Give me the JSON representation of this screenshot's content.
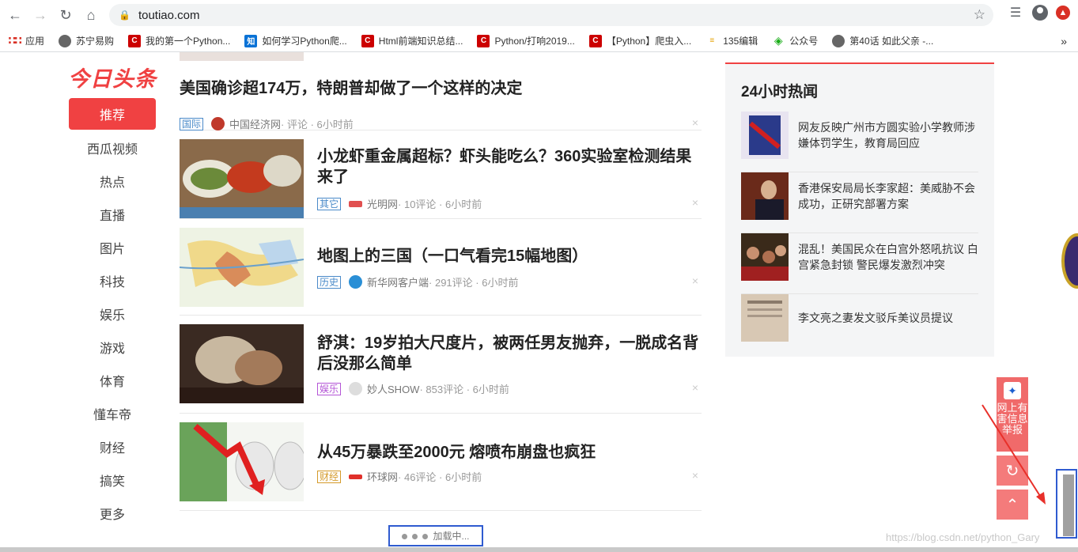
{
  "browser": {
    "url": "toutiao.com",
    "bookmarks": [
      {
        "label": "应用",
        "icon": "apps-icon"
      },
      {
        "label": "苏宁易购",
        "icon": "globe-icon"
      },
      {
        "label": "我的第一个Python...",
        "icon": "csdn-icon"
      },
      {
        "label": "如何学习Python爬...",
        "icon": "zhihu-icon"
      },
      {
        "label": "Html前端知识总结...",
        "icon": "csdn-icon"
      },
      {
        "label": "Python/打响2019...",
        "icon": "csdn-icon"
      },
      {
        "label": "【Python】爬虫入...",
        "icon": "csdn-icon"
      },
      {
        "label": "135编辑",
        "icon": "135-icon"
      },
      {
        "label": "公众号",
        "icon": "wechat-icon"
      },
      {
        "label": "第40话 如此父亲 -...",
        "icon": "globe-icon"
      }
    ],
    "more": "»"
  },
  "logo": "今日头条",
  "nav": [
    "推荐",
    "西瓜视频",
    "热点",
    "直播",
    "图片",
    "科技",
    "娱乐",
    "游戏",
    "体育",
    "懂车帝",
    "财经",
    "搞笑",
    "更多"
  ],
  "feed": [
    {
      "title": "美国确诊超174万，特朗普却做了一个这样的决定",
      "tag": "国际",
      "tag_color": "#4a8ac9",
      "source": "中国经济网",
      "meta": " · 评论 · 6小时前"
    },
    {
      "title": "小龙虾重金属超标？虾头能吃么？360实验室检测结果来了",
      "tag": "其它",
      "tag_color": "#4a8ac9",
      "source": "光明网",
      "meta": " · 10评论 · 6小时前"
    },
    {
      "title": "地图上的三国（一口气看完15幅地图）",
      "tag": "历史",
      "tag_color": "#4a8ac9",
      "source": "新华网客户端",
      "meta": " · 291评论 · 6小时前"
    },
    {
      "title": "舒淇：19岁拍大尺度片，被两任男友抛弃，一脱成名背后没那么简单",
      "tag": "娱乐",
      "tag_color": "#b455d6",
      "source": "妙人SHOW",
      "meta": " · 853评论 · 6小时前"
    },
    {
      "title": "从45万暴跌至2000元 熔喷布崩盘也疯狂",
      "tag": "财经",
      "tag_color": "#d49a2a",
      "source": "环球网",
      "meta": " · 46评论 · 6小时前"
    }
  ],
  "close_glyph": "×",
  "hot": {
    "title": "24小时热闻",
    "items": [
      "网友反映广州市方圆实验小学教师涉嫌体罚学生，教育局回应",
      "香港保安局局长李家超：美威胁不会成功，正研究部署方案",
      "混乱！美国民众在白宫外怒吼抗议 白宫紧急封锁 警民爆发激烈冲突",
      "李文亮之妻发文驳斥美议员提议"
    ]
  },
  "report_label": "网上有害信息举报",
  "loading_text": "加载中...",
  "watermark": "https://blog.csdn.net/python_Gary"
}
